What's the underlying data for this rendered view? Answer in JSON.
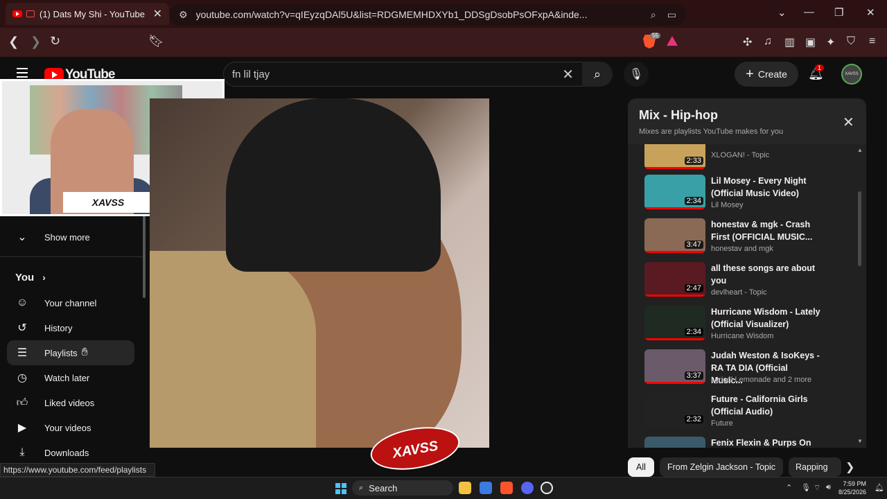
{
  "browser": {
    "tab_title": "(1) Dats My Shi - YouTube",
    "url": "youtube.com/watch?v=qIEyzqDAl5U&list=RDGMEMHDXYb1_DDSgDsobPsOFxpA&inde...",
    "extension_badge": "55",
    "status_link": "https://www.youtube.com/feed/playlists"
  },
  "youtube": {
    "logo_text": "YouTube",
    "search_query": "fn lil tjay",
    "create_label": "Create",
    "notification_count": "1",
    "avatar_text": "XAVSS"
  },
  "sidebar": {
    "show_more": "Show more",
    "you_heading": "You",
    "items": [
      {
        "label": "Your channel",
        "icon": "person-icon"
      },
      {
        "label": "History",
        "icon": "history-icon"
      },
      {
        "label": "Playlists",
        "icon": "playlists-icon"
      },
      {
        "label": "Watch later",
        "icon": "clock-icon"
      },
      {
        "label": "Liked videos",
        "icon": "thumbs-up-icon"
      },
      {
        "label": "Your videos",
        "icon": "play-icon"
      },
      {
        "label": "Downloads",
        "icon": "download-icon"
      }
    ]
  },
  "webcam": {
    "plate_text": "XAVSS"
  },
  "video": {
    "overlay_text": "XAVSS"
  },
  "playlist": {
    "title": "Mix - Hip-hop",
    "subtitle": "Mixes are playlists YouTube makes for you",
    "items": [
      {
        "title": "",
        "channel": "XLOGAN! - Topic",
        "duration": "2:33",
        "color": "#c8a25a"
      },
      {
        "title": "Lil Mosey - Every Night (Official Music Video)",
        "channel": "Lil Mosey",
        "duration": "2:34",
        "color": "#3aa0a8"
      },
      {
        "title": "honestav & mgk - Crash First (OFFICIAL MUSIC...",
        "channel": "honestav and mgk",
        "duration": "3:47",
        "color": "#8a6a55"
      },
      {
        "title": "all these songs are about you",
        "channel": "devlheart - Topic",
        "duration": "2:47",
        "color": "#5a1a22"
      },
      {
        "title": "Hurricane Wisdom - Lately (Official Visualizer)",
        "channel": "Hurricane Wisdom",
        "duration": "2:34",
        "color": "#1f2a22"
      },
      {
        "title": "Judah Weston & IsoKeys - RA TA DIA (Official Music...",
        "channel": "Lyrical Lemonade and 2 more",
        "duration": "3:37",
        "color": "#6b5a6a"
      },
      {
        "title": "Future - California Girls (Official Audio)",
        "channel": "Future",
        "duration": "2:32",
        "color": "#222"
      },
      {
        "title": "Fenix Flexin & Purps On The",
        "channel": "",
        "duration": "",
        "color": "#3a5a6a"
      }
    ]
  },
  "chips": [
    "All",
    "From Zelgin Jackson - Topic",
    "Rapping"
  ],
  "taskbar": {
    "search_label": "Search",
    "time": "7:59 PM",
    "date": "8/25/2026"
  },
  "colors": {
    "brand_red": "#ff0000",
    "chrome_bg": "#2b1112",
    "page_bg": "#0f0f0f"
  }
}
